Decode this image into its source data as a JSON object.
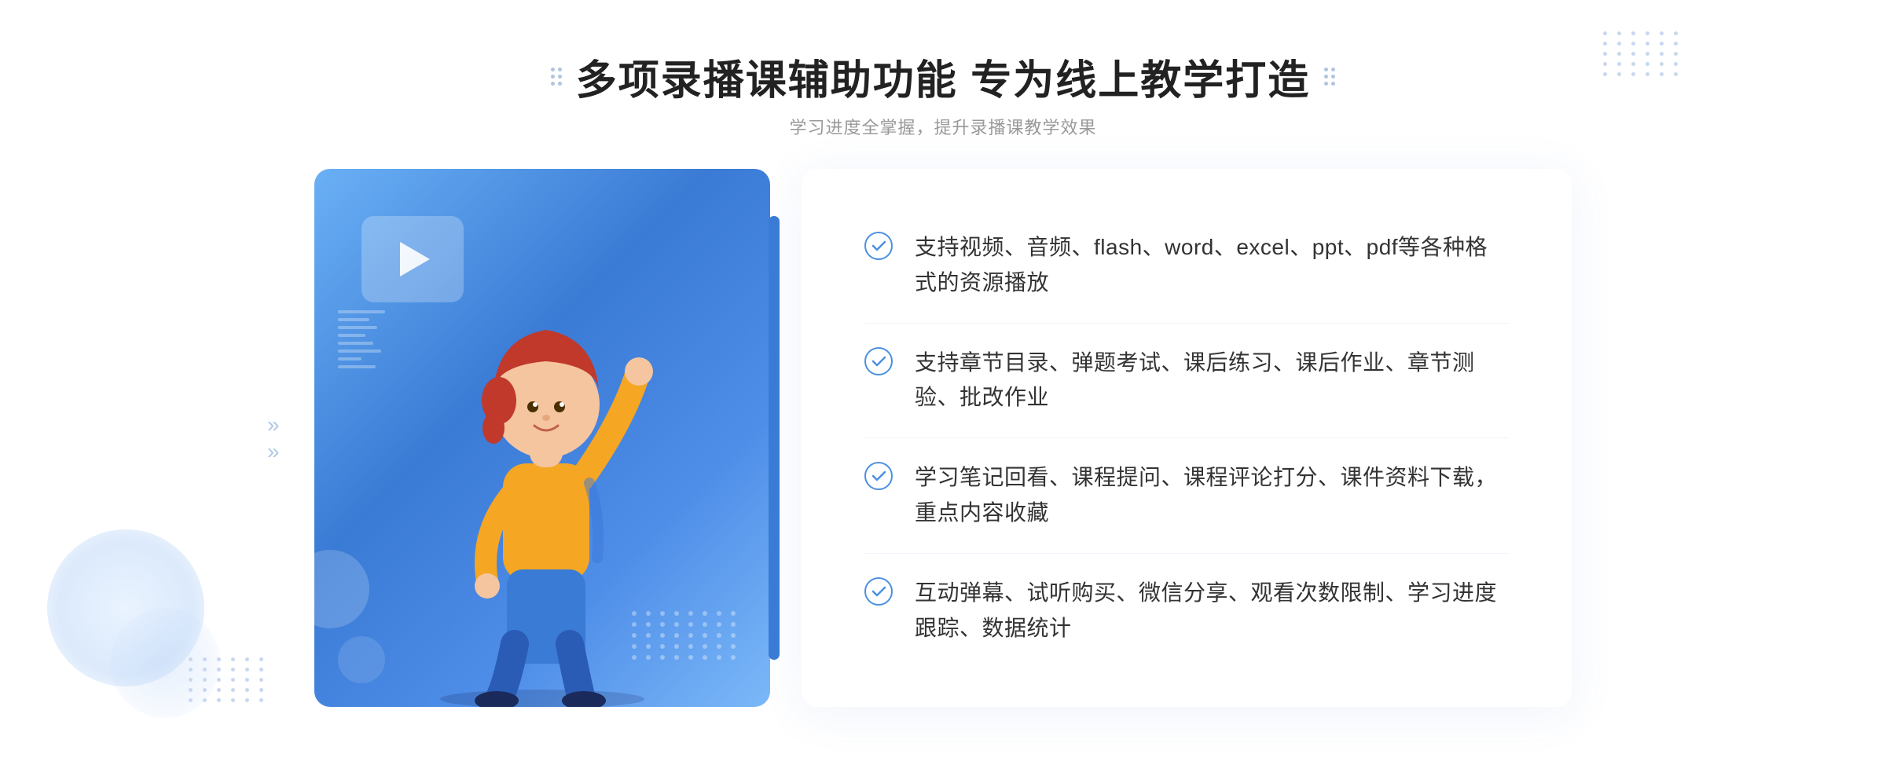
{
  "header": {
    "title": "多项录播课辅助功能 专为线上教学打造",
    "subtitle": "学习进度全掌握，提升录播课教学效果"
  },
  "features": [
    {
      "id": 1,
      "text": "支持视频、音频、flash、word、excel、ppt、pdf等各种格式的资源播放"
    },
    {
      "id": 2,
      "text": "支持章节目录、弹题考试、课后练习、课后作业、章节测验、批改作业"
    },
    {
      "id": 3,
      "text": "学习笔记回看、课程提问、课程评论打分、课件资料下载，重点内容收藏"
    },
    {
      "id": 4,
      "text": "互动弹幕、试听购买、微信分享、观看次数限制、学习进度跟踪、数据统计"
    }
  ],
  "decorative": {
    "left_chevron": "»",
    "dots_icon_left": "⁘",
    "dots_icon_right": "⁘"
  }
}
